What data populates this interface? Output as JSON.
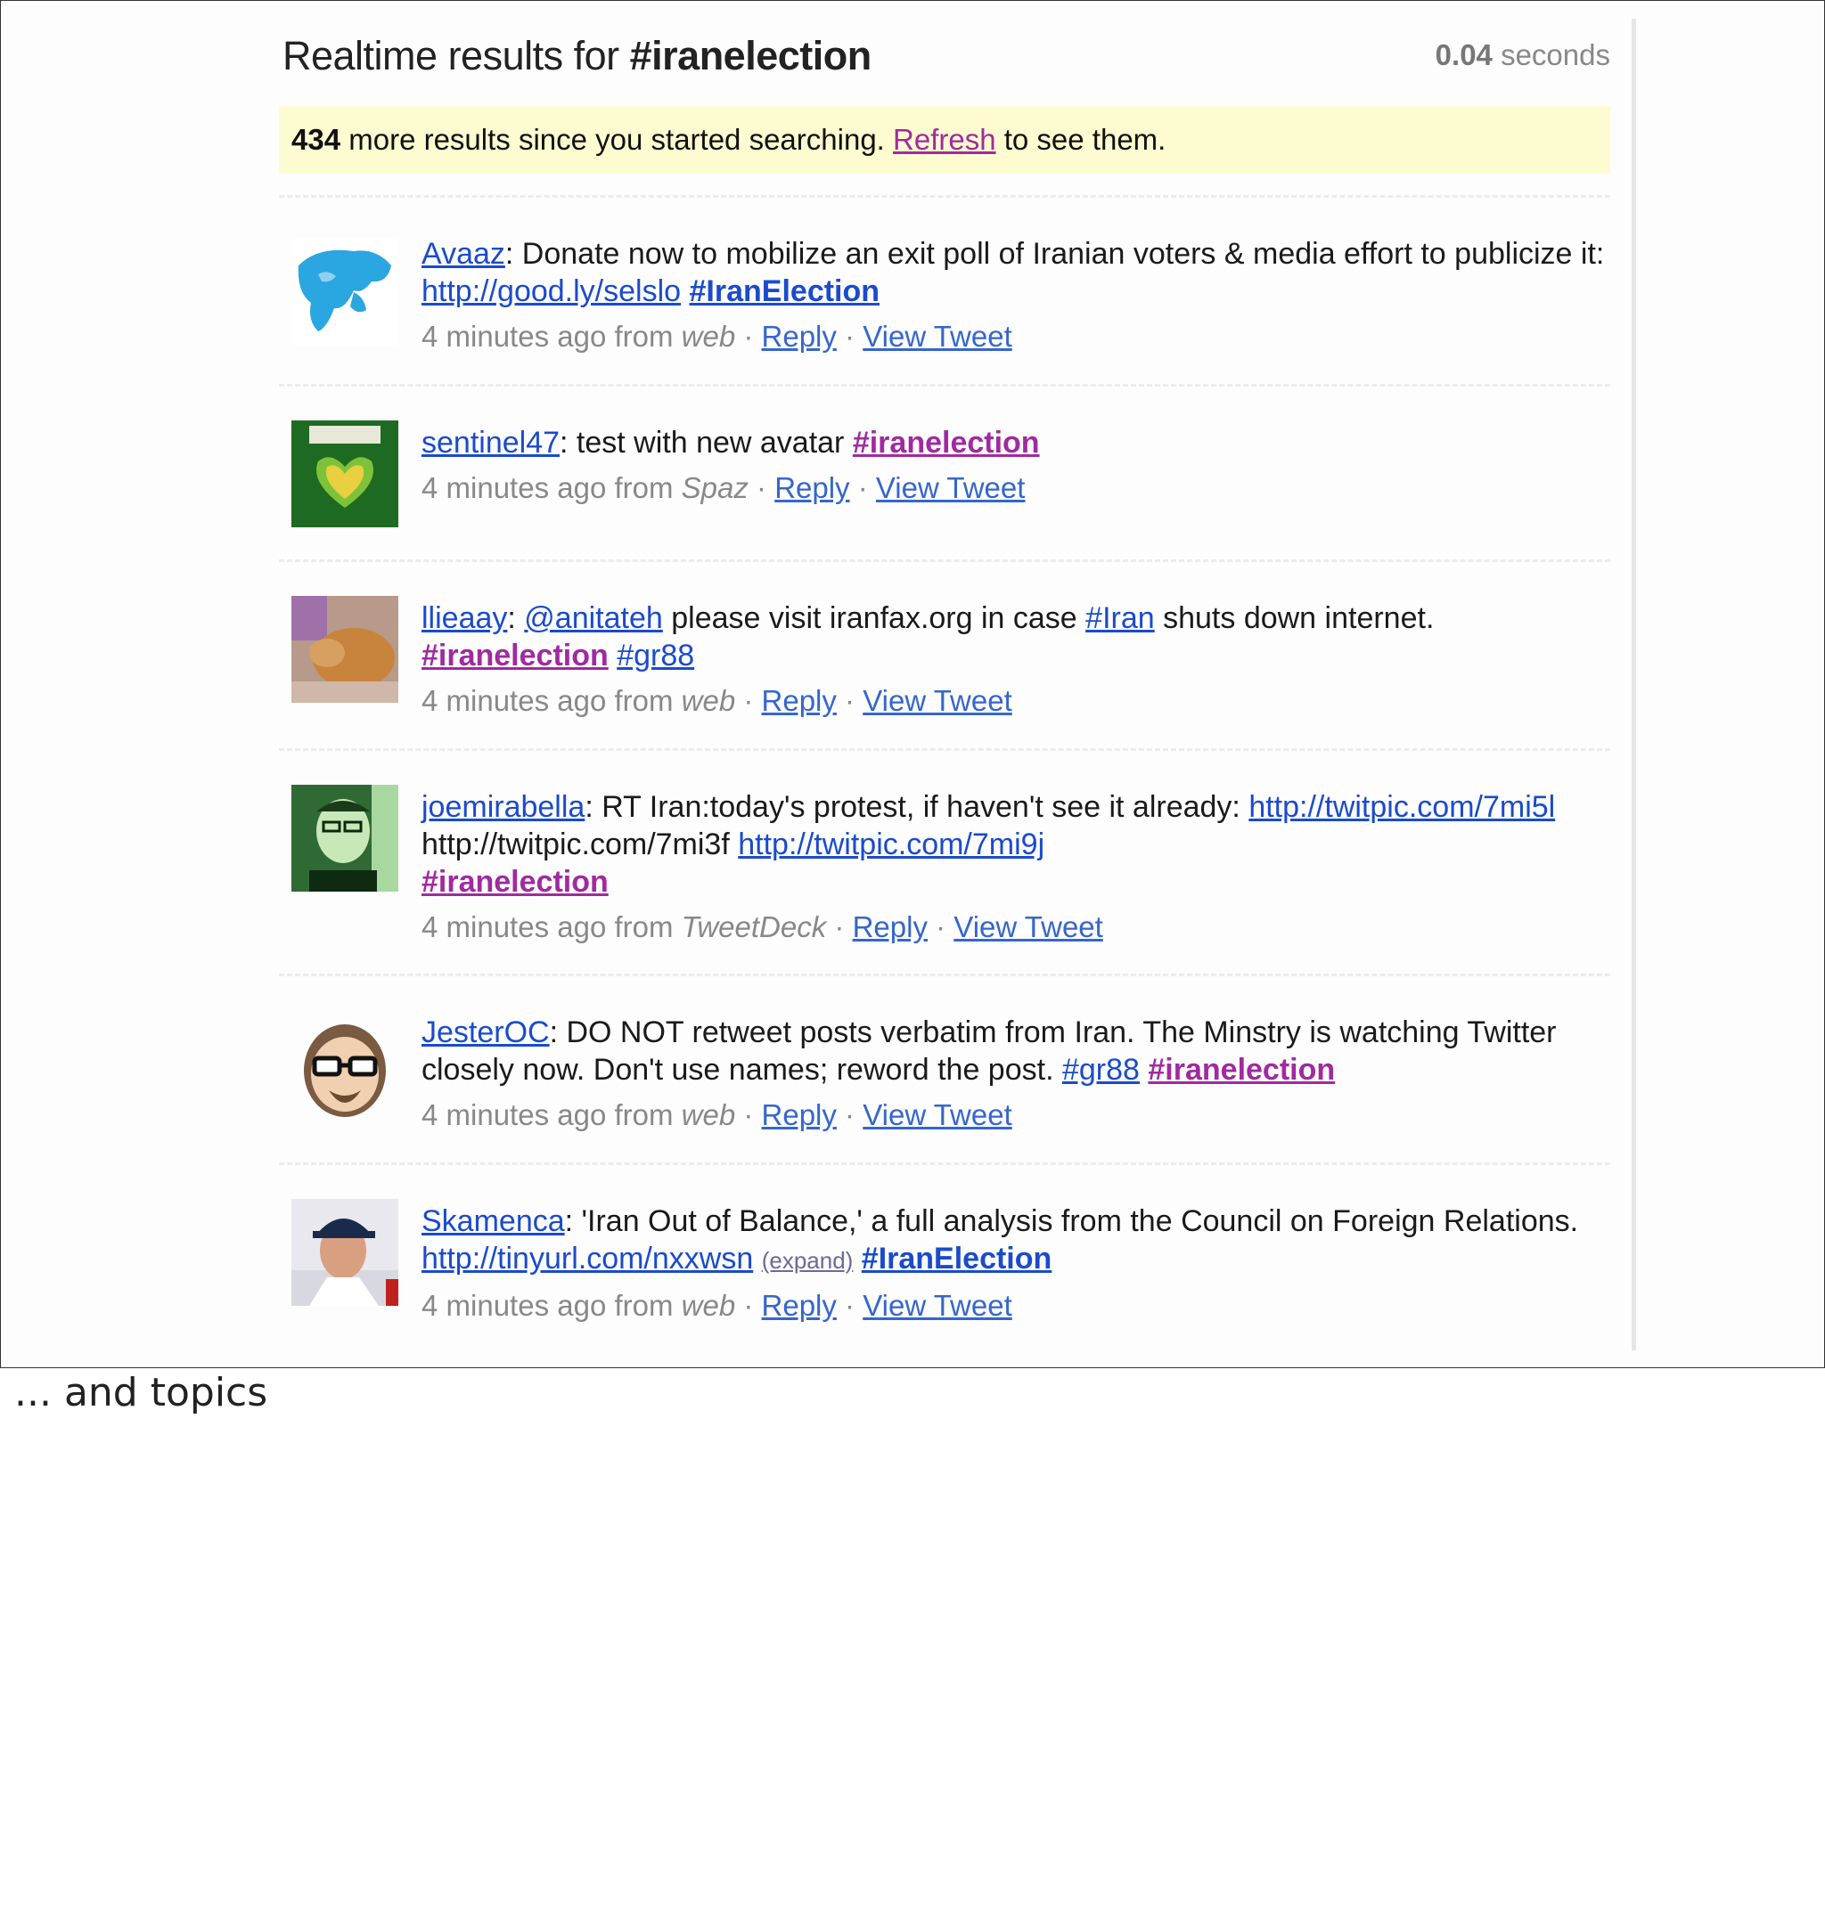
{
  "header": {
    "title_prefix": "Realtime results for ",
    "query": "#iranelection",
    "timing_value": "0.04",
    "timing_unit": " seconds"
  },
  "notice": {
    "count": "434",
    "text_before": " more results since you started searching. ",
    "refresh": "Refresh",
    "text_after": " to see them."
  },
  "tweets": [
    {
      "user": "Avaaz",
      "text1": ": Donate now to mobilize an exit poll of Iranian voters & media effort to publicize it: ",
      "link1": "http://good.ly/selslo",
      "tag1": "#IranElection",
      "time": "4 minutes ago from ",
      "source": "web",
      "reply": "Reply",
      "view": "View Tweet"
    },
    {
      "user": "sentinel47",
      "text1": ": test with new avatar ",
      "tag1": "#iranelection",
      "time": "4 minutes ago from ",
      "source": "Spaz",
      "reply": "Reply",
      "view": "View Tweet"
    },
    {
      "user": "llieaay",
      "mention": "@anitateh",
      "text1": " please visit iranfax.org in case ",
      "tag1": "#Iran",
      "text2": " shuts down internet. ",
      "tag2": "#iranelection",
      "tag3": "#gr88",
      "time": "4 minutes ago from ",
      "source": "web",
      "reply": "Reply",
      "view": "View Tweet"
    },
    {
      "user": "joemirabella",
      "text1": ": RT Iran:today's protest, if haven't see it already: ",
      "link1": "http://twitpic.com/7mi5l",
      "text2": " http://twitpic.com/7mi3f ",
      "link2": "http://twitpic.com/7mi9j",
      "tag1": "#iranelection",
      "time": "4 minutes ago from ",
      "source": "TweetDeck",
      "reply": "Reply",
      "view": "View Tweet"
    },
    {
      "user": "JesterOC",
      "text1": ": DO NOT retweet posts verbatim from Iran. The Minstry is watching Twitter closely now. Don't use names; reword the post. ",
      "tag1": "#gr88",
      "tag2": "#iranelection",
      "time": "4 minutes ago from ",
      "source": "web",
      "reply": "Reply",
      "view": "View Tweet"
    },
    {
      "user": "Skamenca",
      "text1": ": 'Iran Out of Balance,' a full analysis from the Council on Foreign Relations. ",
      "link1": "http://tinyurl.com/nxxwsn",
      "expand": "(expand)",
      "tag1": "#IranElection",
      "time": "4 minutes ago from ",
      "source": "web",
      "reply": "Reply",
      "view": "View Tweet"
    }
  ],
  "separator": " · ",
  "caption": "... and topics"
}
